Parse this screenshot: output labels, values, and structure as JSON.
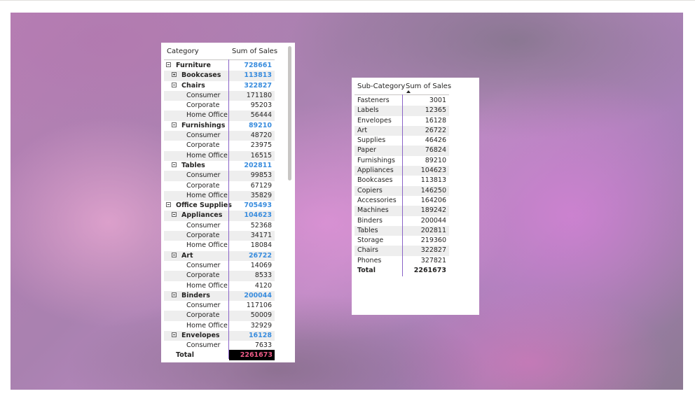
{
  "matrix": {
    "headers": {
      "category": "Category",
      "value": "Sum of Sales"
    },
    "rows": [
      {
        "level": 0,
        "label": "Furniture",
        "value": "728661",
        "expanded": true
      },
      {
        "level": 1,
        "label": "Bookcases",
        "value": "113813",
        "expanded": false
      },
      {
        "level": 1,
        "label": "Chairs",
        "value": "322827",
        "expanded": true
      },
      {
        "level": 2,
        "label": "Consumer",
        "value": "171180"
      },
      {
        "level": 2,
        "label": "Corporate",
        "value": "95203"
      },
      {
        "level": 2,
        "label": "Home Office",
        "value": "56444"
      },
      {
        "level": 1,
        "label": "Furnishings",
        "value": "89210",
        "expanded": true
      },
      {
        "level": 2,
        "label": "Consumer",
        "value": "48720"
      },
      {
        "level": 2,
        "label": "Corporate",
        "value": "23975"
      },
      {
        "level": 2,
        "label": "Home Office",
        "value": "16515"
      },
      {
        "level": 1,
        "label": "Tables",
        "value": "202811",
        "expanded": true
      },
      {
        "level": 2,
        "label": "Consumer",
        "value": "99853"
      },
      {
        "level": 2,
        "label": "Corporate",
        "value": "67129"
      },
      {
        "level": 2,
        "label": "Home Office",
        "value": "35829"
      },
      {
        "level": 0,
        "label": "Office Supplies",
        "value": "705493",
        "expanded": true
      },
      {
        "level": 1,
        "label": "Appliances",
        "value": "104623",
        "expanded": true
      },
      {
        "level": 2,
        "label": "Consumer",
        "value": "52368"
      },
      {
        "level": 2,
        "label": "Corporate",
        "value": "34171"
      },
      {
        "level": 2,
        "label": "Home Office",
        "value": "18084"
      },
      {
        "level": 1,
        "label": "Art",
        "value": "26722",
        "expanded": true
      },
      {
        "level": 2,
        "label": "Consumer",
        "value": "14069"
      },
      {
        "level": 2,
        "label": "Corporate",
        "value": "8533"
      },
      {
        "level": 2,
        "label": "Home Office",
        "value": "4120"
      },
      {
        "level": 1,
        "label": "Binders",
        "value": "200044",
        "expanded": true
      },
      {
        "level": 2,
        "label": "Consumer",
        "value": "117106"
      },
      {
        "level": 2,
        "label": "Corporate",
        "value": "50009"
      },
      {
        "level": 2,
        "label": "Home Office",
        "value": "32929"
      },
      {
        "level": 1,
        "label": "Envelopes",
        "value": "16128",
        "expanded": true
      },
      {
        "level": 2,
        "label": "Consumer",
        "value": "7633"
      }
    ],
    "total": {
      "label": "Total",
      "value": "2261673"
    }
  },
  "subcategory_table": {
    "headers": {
      "category": "Sub-Category",
      "value": "Sum of Sales"
    },
    "sort": "ascending by Sum of Sales",
    "rows": [
      {
        "label": "Fasteners",
        "value": "3001"
      },
      {
        "label": "Labels",
        "value": "12365"
      },
      {
        "label": "Envelopes",
        "value": "16128"
      },
      {
        "label": "Art",
        "value": "26722"
      },
      {
        "label": "Supplies",
        "value": "46426"
      },
      {
        "label": "Paper",
        "value": "76824"
      },
      {
        "label": "Furnishings",
        "value": "89210"
      },
      {
        "label": "Appliances",
        "value": "104623"
      },
      {
        "label": "Bookcases",
        "value": "113813"
      },
      {
        "label": "Copiers",
        "value": "146250"
      },
      {
        "label": "Accessories",
        "value": "164206"
      },
      {
        "label": "Machines",
        "value": "189242"
      },
      {
        "label": "Binders",
        "value": "200044"
      },
      {
        "label": "Tables",
        "value": "202811"
      },
      {
        "label": "Storage",
        "value": "219360"
      },
      {
        "label": "Chairs",
        "value": "322827"
      },
      {
        "label": "Phones",
        "value": "327821"
      }
    ],
    "total": {
      "label": "Total",
      "value": "2261673"
    }
  },
  "colors": {
    "subtotal_value": "#3a8dde",
    "total_value": "#ef5b87",
    "total_cell_bg": "#000000",
    "column_divider": "#8a63c7",
    "alt_row": "#eeeeee"
  },
  "icons": {
    "expanded": "collapse-minus-icon",
    "collapsed": "expand-plus-icon",
    "sort": "sort-ascending-icon"
  }
}
